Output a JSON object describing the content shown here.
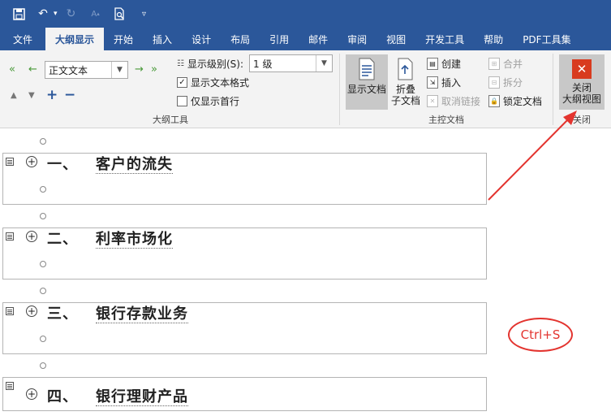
{
  "quick_access": {
    "icons": [
      "save-icon",
      "undo-icon",
      "redo-icon",
      "font-size-icon",
      "print-preview-icon",
      "customize-icon"
    ]
  },
  "tabs": [
    {
      "label": "文件"
    },
    {
      "label": "大纲显示",
      "active": true
    },
    {
      "label": "开始"
    },
    {
      "label": "插入"
    },
    {
      "label": "设计"
    },
    {
      "label": "布局"
    },
    {
      "label": "引用"
    },
    {
      "label": "邮件"
    },
    {
      "label": "审阅"
    },
    {
      "label": "视图"
    },
    {
      "label": "开发工具"
    },
    {
      "label": "帮助"
    },
    {
      "label": "PDF工具集"
    }
  ],
  "outline_tools": {
    "group_label": "大纲工具",
    "level_style": "正文文本",
    "show_level_label": "显示级别(S):",
    "show_level_value": "1 级",
    "show_text_format": {
      "label": "显示文本格式",
      "checked": true
    },
    "show_first_line": {
      "label": "仅显示首行",
      "checked": false
    }
  },
  "master_document": {
    "group_label": "主控文档",
    "show_document": "显示文档",
    "collapse_subdocs_line1": "折叠",
    "collapse_subdocs_line2": "子文档",
    "create": "创建",
    "insert": "插入",
    "unlink": "取消链接",
    "merge": "合并",
    "split": "拆分",
    "lock_document": "锁定文档"
  },
  "close_group": {
    "group_label": "关闭",
    "close_line1": "关闭",
    "close_line2": "大纲视图"
  },
  "outline": [
    {
      "number": "一、",
      "title": "客户的流失"
    },
    {
      "number": "二、",
      "title": "利率市场化"
    },
    {
      "number": "三、",
      "title": "银行存款业务"
    },
    {
      "number": "四、",
      "title": "银行理财产品"
    }
  ],
  "annotation": {
    "shortcut": "Ctrl+S"
  },
  "colors": {
    "ribbon_blue": "#2b579a",
    "annotation_red": "#e3342f",
    "close_icon_red": "#d83b1f"
  }
}
